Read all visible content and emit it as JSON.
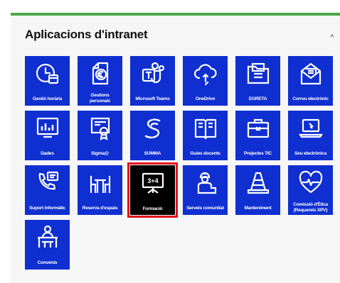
{
  "panel": {
    "title": "Aplicacions d'intranet",
    "collapse_glyph": "^",
    "accent_color": "#4aa946",
    "tile_color": "#0f2fd0",
    "selected_tile_color": "#000000",
    "selected_outline_color": "#e3111b"
  },
  "apps": [
    {
      "label": "Gestió horària",
      "icon": "clock-calendar-icon"
    },
    {
      "label": "Gestions personals",
      "icon": "euro-document-icon"
    },
    {
      "label": "Microsoft Teams",
      "icon": "teams-icon"
    },
    {
      "label": "OneDrive",
      "icon": "cloud-sync-icon"
    },
    {
      "label": "EGRETA",
      "icon": "folder-doc-icon"
    },
    {
      "label": "Correu electrònic",
      "icon": "envelope-icon"
    },
    {
      "label": "Dades",
      "icon": "bar-chart-icon"
    },
    {
      "label": "Sigma@",
      "icon": "certificate-icon"
    },
    {
      "label": "SUMMA",
      "icon": "summa-logo-icon"
    },
    {
      "label": "Guies docents",
      "icon": "open-book-icon"
    },
    {
      "label": "Projectes TIC",
      "icon": "briefcase-icon"
    },
    {
      "label": "Seu electrònica",
      "icon": "laptop-icon"
    },
    {
      "label": "Suport informàtic",
      "icon": "phone-support-icon"
    },
    {
      "label": "Reserva d'espais",
      "icon": "table-chairs-icon"
    },
    {
      "label": "Formació",
      "icon": "blackboard-icon",
      "board_text": "3+4"
    },
    {
      "label": "Serveis comunitat",
      "icon": "service-worker-icon"
    },
    {
      "label": "Manteniment",
      "icon": "traffic-cone-icon"
    },
    {
      "label": "Comissió d'Ètica (Requereix XPV)",
      "icon": "heartbeat-icon"
    },
    {
      "label": "Convenis",
      "icon": "meeting-podium-icon"
    }
  ]
}
